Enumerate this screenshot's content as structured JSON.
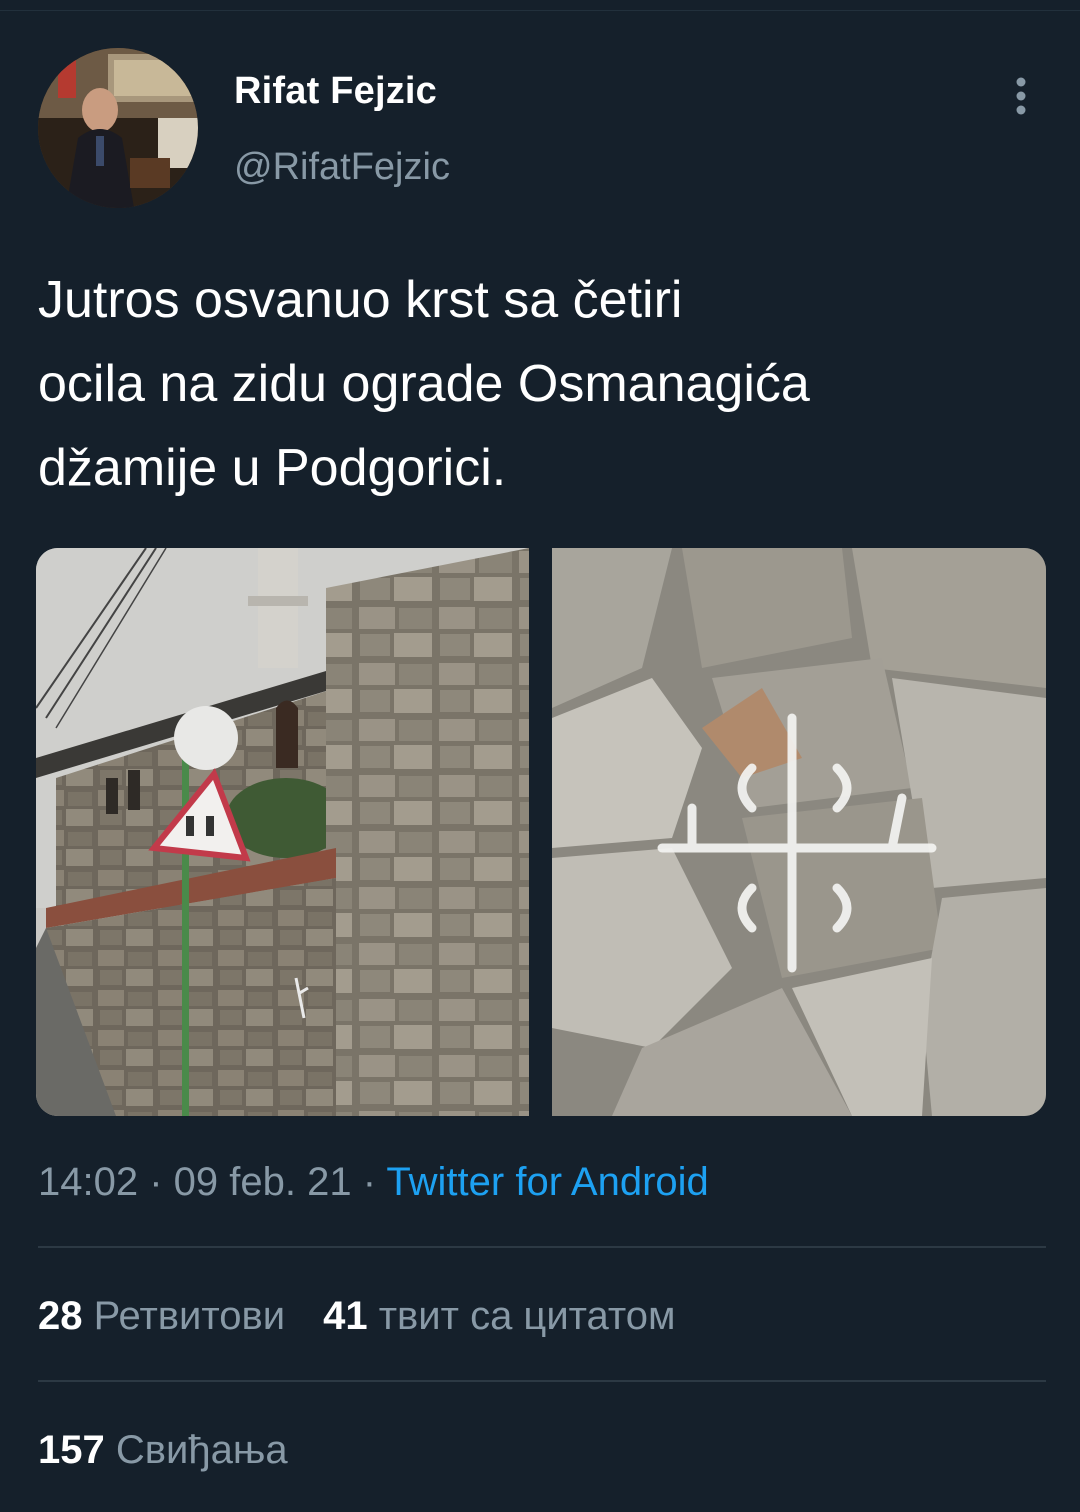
{
  "author": {
    "name": "Rifat Fejzic",
    "handle": "@RifatFejzic"
  },
  "tweet": {
    "lines": [
      "Jutros osvanuo krst sa četiri",
      "ocila na zidu ograde Osmanagića",
      "džamije u Podgorici."
    ]
  },
  "meta": {
    "time": "14:02",
    "separator": " · ",
    "date": "09 feb. 21",
    "source": "Twitter for Android"
  },
  "stats": {
    "retweets_count": "28",
    "retweets_label": "Ретвитови",
    "quotes_count": "41",
    "quotes_label": "твит са цитатом",
    "likes_count": "157",
    "likes_label": "Свиђања"
  },
  "colors": {
    "background": "#15202b",
    "text": "#ffffff",
    "secondary": "#8899a6",
    "link": "#1da1f2",
    "divider": "#2c3944"
  },
  "icons": {
    "more": "more-vertical-icon"
  }
}
